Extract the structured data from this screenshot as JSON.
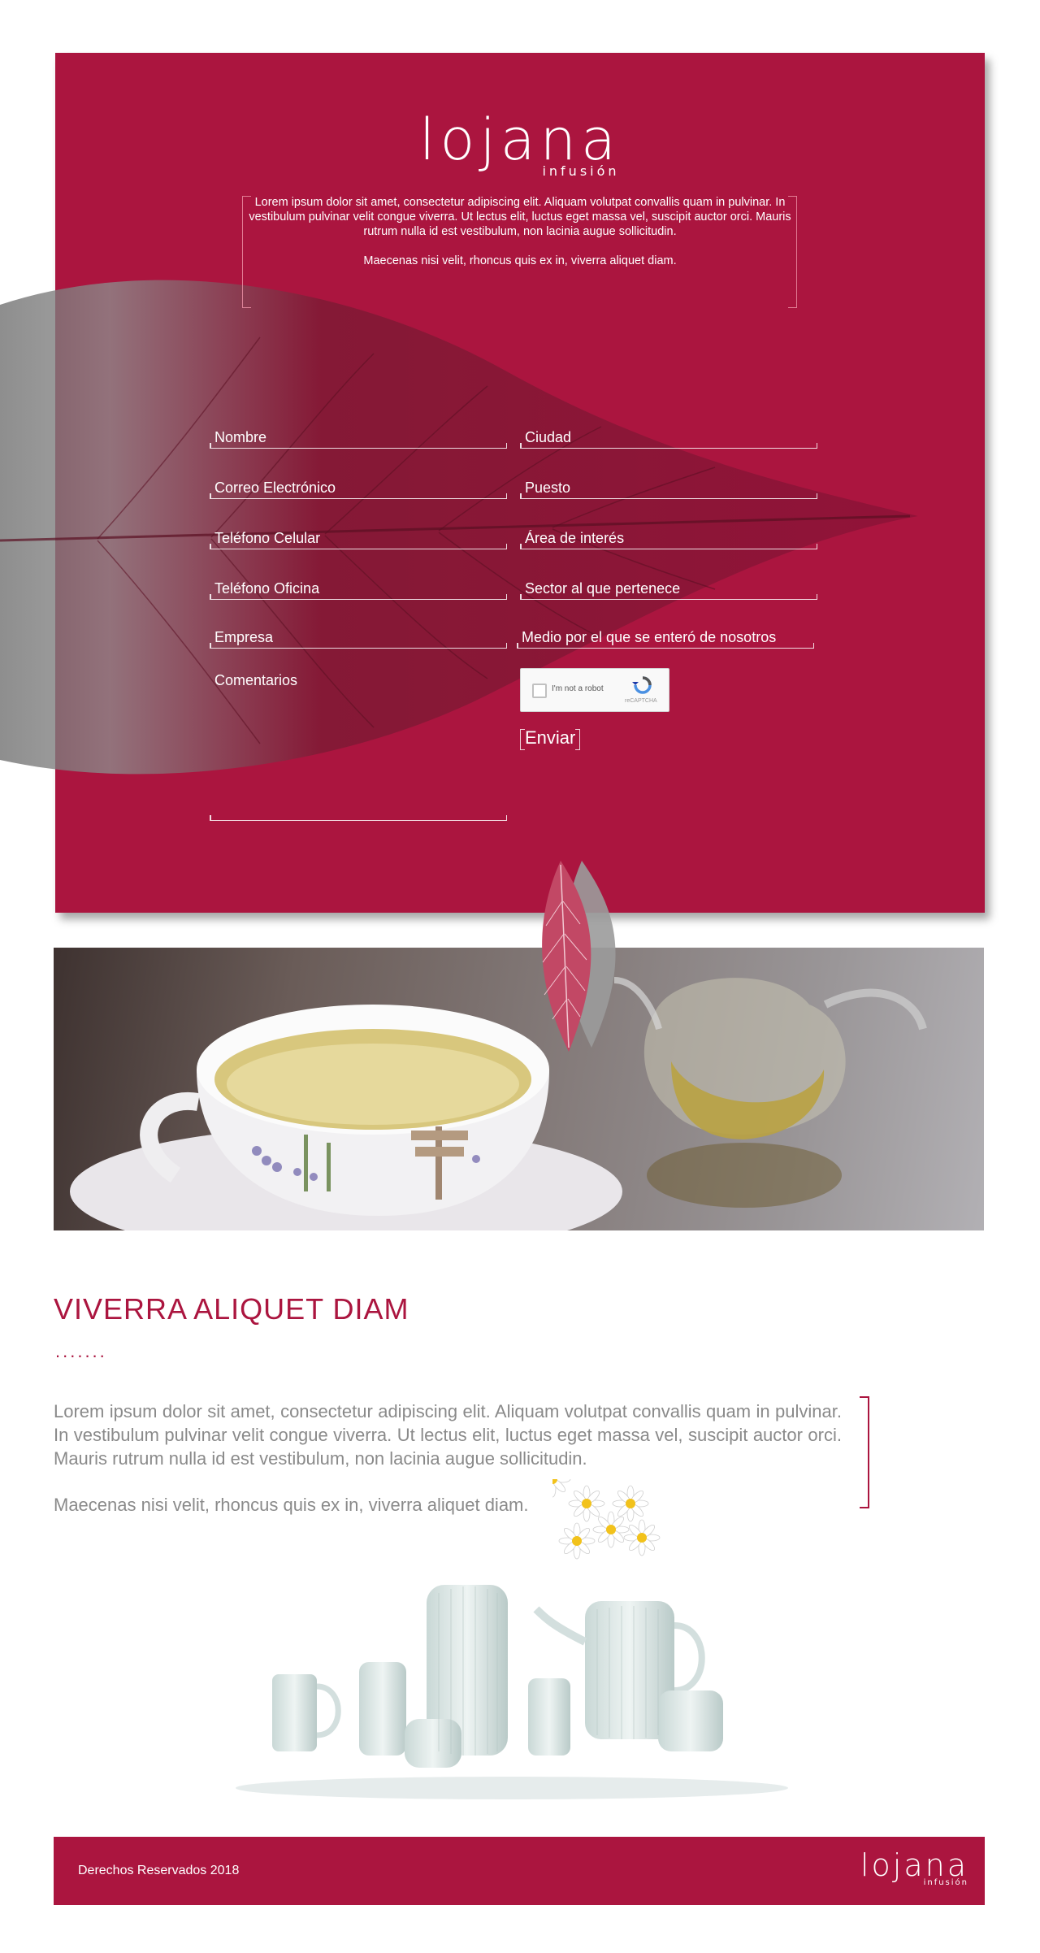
{
  "brand": {
    "name": "lojana",
    "tagline": "infusión",
    "color": "#ab153f"
  },
  "hero": {
    "intro_p1": "Lorem ipsum dolor sit amet, consectetur adipiscing elit. Aliquam volutpat convallis quam in pulvinar. In vestibulum pulvinar velit congue viverra. Ut lectus elit, luctus eget massa vel, suscipit auctor orci. Mauris rutrum nulla id est vestibulum, non lacinia augue sollicitudin.",
    "intro_p2": "Maecenas nisi velit, rhoncus quis ex in, viverra aliquet diam."
  },
  "form": {
    "nombre": "Nombre",
    "ciudad": "Ciudad",
    "correo": "Correo Electrónico",
    "puesto": "Puesto",
    "telefono_celular": "Teléfono Celular",
    "area_interes": "Área de interés",
    "telefono_oficina": "Teléfono  Oficina",
    "sector": "Sector al que pertenece",
    "empresa": "Empresa",
    "medio": "Medio por el que se enteró de nosotros",
    "comentarios": "Comentarios",
    "recaptcha_text": "I'm not a robot",
    "recaptcha_brand": "reCAPTCHA",
    "submit": "Enviar"
  },
  "section": {
    "title": "VIVERRA ALIQUET DIAM",
    "dots": ".......",
    "body_p1": "Lorem ipsum dolor sit amet, consectetur adipiscing elit. Aliquam volutpat convallis quam in pulvinar. In vestibulum pulvinar velit congue viverra. Ut lectus elit, luctus eget massa vel, suscipit auctor orci. Mauris rutrum nulla id est vestibulum, non lacinia augue sollicitudin.",
    "body_p2": "Maecenas nisi velit, rhoncus quis ex in, viverra aliquet diam."
  },
  "footer": {
    "copyright": "Derechos Reservados  2018"
  }
}
